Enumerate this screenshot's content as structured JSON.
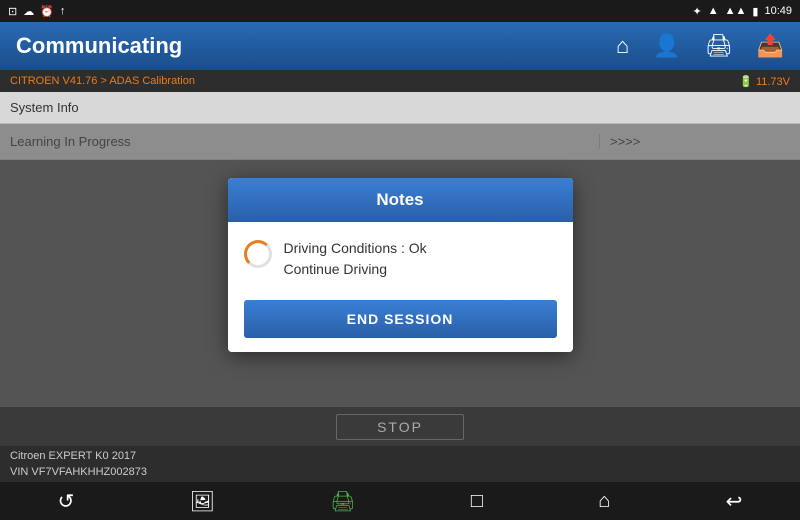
{
  "statusBar": {
    "leftIcons": [
      "⊡",
      "☁",
      "⏰",
      "↑"
    ],
    "time": "10:49",
    "rightIcons": [
      "✦",
      "▲",
      "📶",
      "🔋"
    ]
  },
  "header": {
    "title": "Communicating",
    "icons": [
      "home",
      "user",
      "print",
      "export"
    ]
  },
  "breadcrumb": {
    "text": "CITROEN V41.76 > ADAS Calibration",
    "battery": "🔋 11.73V"
  },
  "systemInfo": {
    "label": "System Info"
  },
  "learningRow": {
    "label": "Learning In Progress",
    "value": ">>>>"
  },
  "dialog": {
    "title": "Notes",
    "message_line1": "Driving Conditions : Ok",
    "message_line2": "Continue Driving",
    "endSessionLabel": "END SESSION"
  },
  "stopBar": {
    "label": "STOP"
  },
  "footer": {
    "line1": "Citroen EXPERT K0 2017",
    "line2": "VIN VF7VFAHKHHZ002873"
  },
  "bottomNav": {
    "icons": [
      "refresh",
      "image",
      "printer",
      "square",
      "home",
      "back"
    ]
  }
}
